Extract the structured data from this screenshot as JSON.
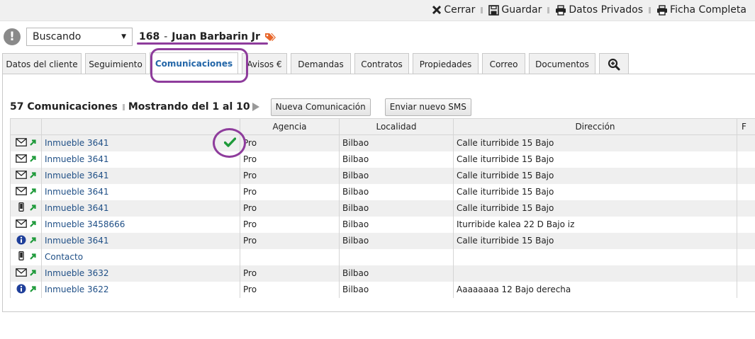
{
  "toolbar": {
    "close_label": "Cerrar",
    "save_label": "Guardar",
    "private_label": "Datos Privados",
    "full_sheet_label": "Ficha Completa"
  },
  "header": {
    "status_value": "Buscando",
    "client_id": "168",
    "client_separator": "-",
    "client_name": "Juan Barbarin Jr"
  },
  "tabs": [
    {
      "label": "Datos del cliente",
      "active": false
    },
    {
      "label": "Seguimiento",
      "active": false
    },
    {
      "label": "Comunicaciones",
      "active": true
    },
    {
      "label": "Avisos €",
      "active": false
    },
    {
      "label": "Demandas",
      "active": false
    },
    {
      "label": "Contratos",
      "active": false
    },
    {
      "label": "Propiedades",
      "active": false
    },
    {
      "label": "Correo",
      "active": false
    },
    {
      "label": "Documentos",
      "active": false
    },
    {
      "label": "",
      "icon": "zoom-in-icon",
      "active": false
    }
  ],
  "list": {
    "count_label": "57 Comunicaciones",
    "showing_label": "Mostrando del 1 al 10",
    "new_button": "Nueva Comunicación",
    "sms_button": "Enviar nuevo SMS"
  },
  "table": {
    "columns": [
      "",
      "Agencia",
      "Localidad",
      "Dirección",
      "F"
    ],
    "rows": [
      {
        "type": "mail-icon",
        "subject": "Inmueble 3641",
        "checked": true,
        "agencia": "Pro",
        "localidad": "Bilbao",
        "direccion": "Calle iturribide 15 Bajo"
      },
      {
        "type": "mail-icon",
        "subject": "Inmueble 3641",
        "checked": false,
        "agencia": "Pro",
        "localidad": "Bilbao",
        "direccion": "Calle iturribide 15 Bajo"
      },
      {
        "type": "mail-icon",
        "subject": "Inmueble 3641",
        "checked": false,
        "agencia": "Pro",
        "localidad": "Bilbao",
        "direccion": "Calle iturribide 15 Bajo"
      },
      {
        "type": "mail-icon",
        "subject": "Inmueble 3641",
        "checked": false,
        "agencia": "Pro",
        "localidad": "Bilbao",
        "direccion": "Calle iturribide 15 Bajo"
      },
      {
        "type": "mobile-icon",
        "subject": "Inmueble 3641",
        "checked": false,
        "agencia": "Pro",
        "localidad": "Bilbao",
        "direccion": "Calle iturribide 15 Bajo"
      },
      {
        "type": "mail-icon",
        "subject": "Inmueble 3458666",
        "checked": false,
        "agencia": "Pro",
        "localidad": "Bilbao",
        "direccion": "Iturribide kalea 22 D Bajo iz"
      },
      {
        "type": "info-icon",
        "subject": "Inmueble 3641",
        "checked": false,
        "agencia": "Pro",
        "localidad": "Bilbao",
        "direccion": "Calle iturribide 15 Bajo"
      },
      {
        "type": "mobile-icon",
        "subject": "Contacto",
        "checked": false,
        "agencia": "",
        "localidad": "",
        "direccion": ""
      },
      {
        "type": "mail-icon",
        "subject": "Inmueble 3632",
        "checked": false,
        "agencia": "Pro",
        "localidad": "Bilbao",
        "direccion": ""
      },
      {
        "type": "info-icon",
        "subject": "Inmueble 3622",
        "checked": false,
        "agencia": "Pro",
        "localidad": "Bilbao",
        "direccion": "Aaaaaaaa 12 Bajo derecha"
      }
    ]
  },
  "colors": {
    "accent_link": "#1f4f86",
    "active_tab_text": "#2366a8",
    "annotation": "#8e3c9c",
    "outgoing_arrow": "#1e9a3a",
    "info_icon": "#1f3f9a"
  }
}
